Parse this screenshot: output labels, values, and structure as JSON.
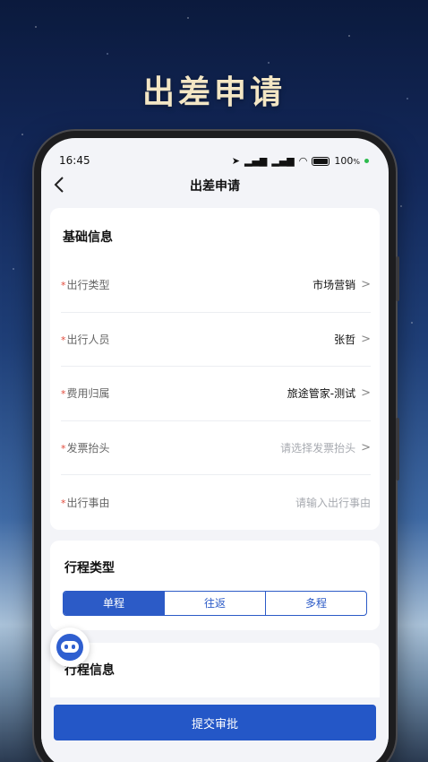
{
  "hero": {
    "title": "出差申请"
  },
  "status_bar": {
    "time": "16:45",
    "battery": "100",
    "battery_unit": "%"
  },
  "nav": {
    "back_icon": "chevron-left-icon",
    "title": "出差申请"
  },
  "basic_info": {
    "title": "基础信息",
    "required_mark": "*",
    "rows": [
      {
        "label": "出行类型",
        "value": "市场营销",
        "placeholder": false,
        "chevron": true
      },
      {
        "label": "出行人员",
        "value": "张哲",
        "placeholder": false,
        "chevron": true
      },
      {
        "label": "费用归属",
        "value": "旅途管家-测试",
        "placeholder": false,
        "chevron": true
      },
      {
        "label": "发票抬头",
        "value": "请选择发票抬头",
        "placeholder": true,
        "chevron": true
      },
      {
        "label": "出行事由",
        "value": "请输入出行事由",
        "placeholder": true,
        "chevron": false
      }
    ]
  },
  "trip_type": {
    "title": "行程类型",
    "options": [
      "单程",
      "往返",
      "多程"
    ],
    "selected": "单程"
  },
  "trip_info": {
    "title": "行程信息"
  },
  "assistant": {
    "icon": "robot-assistant-icon"
  },
  "submit": {
    "label": "提交审批"
  },
  "colors": {
    "accent": "#2c5bc7",
    "required": "#e24a3b",
    "hero_title": "#f3e6c4"
  }
}
